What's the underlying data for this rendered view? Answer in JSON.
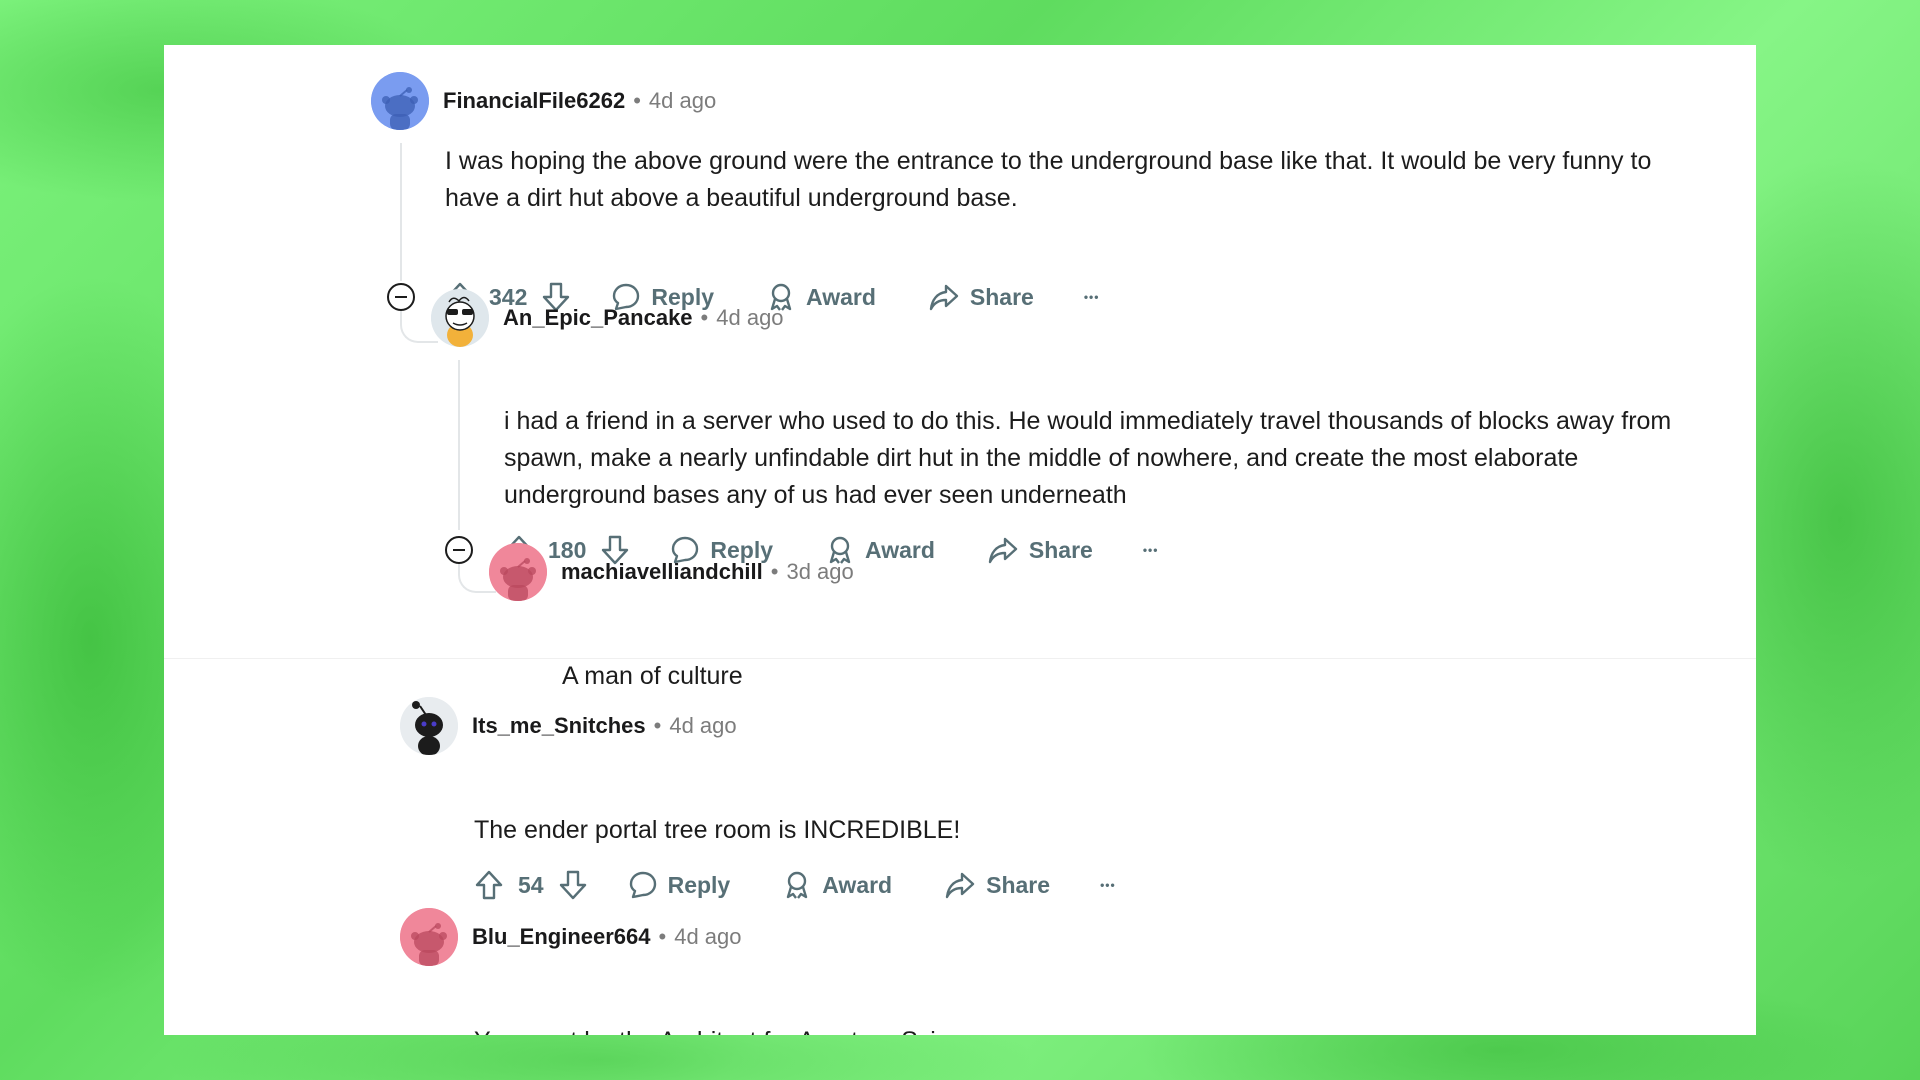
{
  "comments": [
    {
      "username": "FinancialFile6262",
      "sep": "•",
      "time": "4d ago",
      "avatar_color": "#7a9cf0",
      "text": "I was hoping the above ground were the entrance to the underground base like that. It would be very funny to have a dirt hut above a beautiful underground base.",
      "votes": "342"
    },
    {
      "username": "An_Epic_Pancake",
      "sep": "•",
      "time": "4d ago",
      "avatar_color": "#dfe7ec",
      "text": "i had a friend in a server who used to do this. He would immediately travel thousands of blocks away from spawn, make a nearly unfindable dirt hut in the middle of nowhere, and create the most elaborate underground bases any of us had ever seen underneath",
      "votes": "180"
    },
    {
      "username": "machiavelliandchill",
      "sep": "•",
      "time": "3d ago",
      "avatar_color": "#f0879a",
      "text": "A man of culture"
    },
    {
      "username": "Its_me_Snitches",
      "sep": "•",
      "time": "4d ago",
      "avatar_color": "#e8ecef",
      "text": "The ender portal tree room is INCREDIBLE!",
      "votes": "54"
    },
    {
      "username": "Blu_Engineer664",
      "sep": "•",
      "time": "4d ago",
      "avatar_color": "#f0879a",
      "text": "You must be the Architect for Aperture Science"
    }
  ],
  "actions": {
    "reply": "Reply",
    "award": "Award",
    "share": "Share",
    "more": "•••"
  },
  "icons": {
    "upvote": "upvote-arrow-icon",
    "downvote": "downvote-arrow-icon",
    "reply": "speech-bubble-icon",
    "award": "award-ribbon-icon",
    "share": "share-arrow-icon",
    "collapse": "collapse-minus-icon"
  },
  "colors": {
    "background_green": "#6ee86e",
    "card": "#ffffff",
    "text": "#1c1c1c",
    "meta": "#7c7c7c",
    "action": "#576f76"
  }
}
